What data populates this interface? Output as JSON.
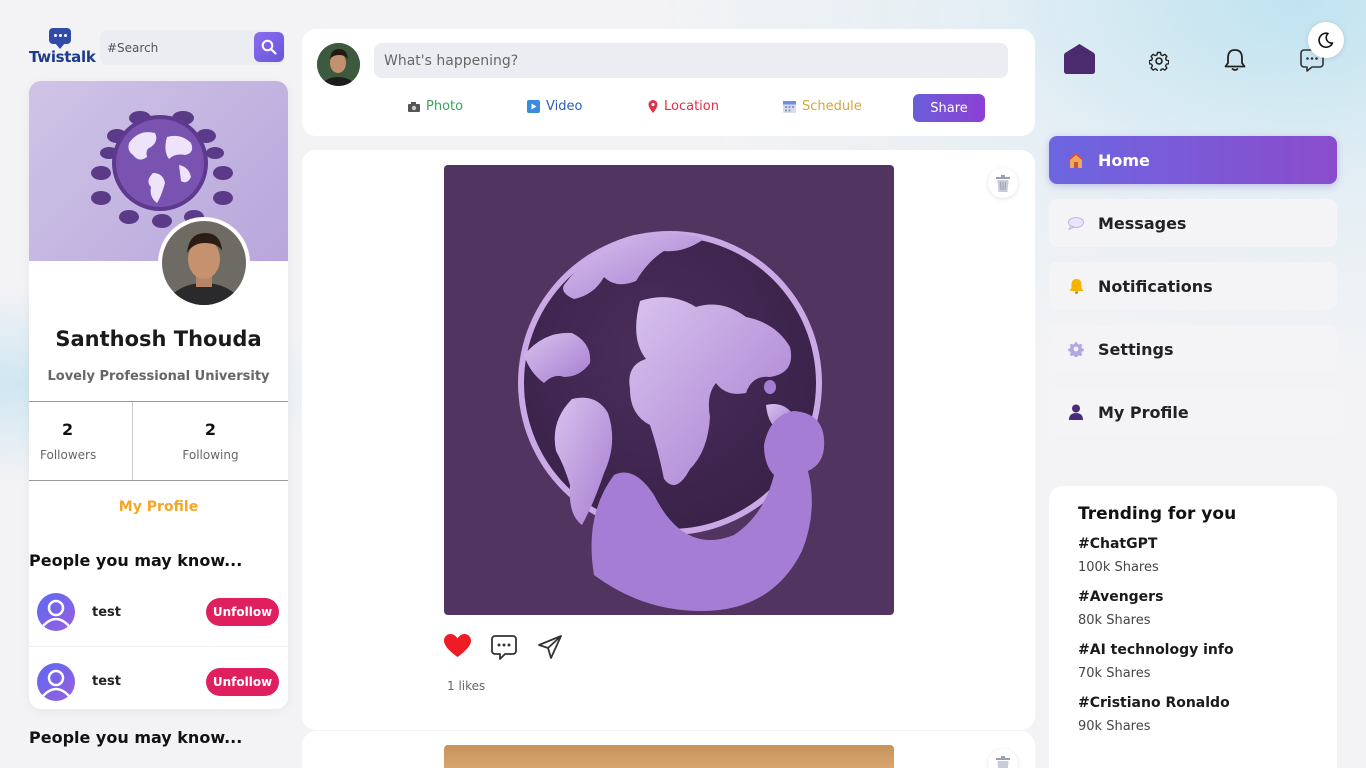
{
  "app": {
    "name": "Twistalk"
  },
  "search": {
    "placeholder": "#Search"
  },
  "profile": {
    "name": "Santhosh Thouda",
    "university": "Lovely Professional University",
    "followers_count": "2",
    "followers_label": "Followers",
    "following_count": "2",
    "following_label": "Following",
    "my_profile_link": "My Profile"
  },
  "suggestions": {
    "title": "People you may know...",
    "items": [
      {
        "name": "test",
        "action": "Unfollow"
      },
      {
        "name": "test",
        "action": "Unfollow"
      }
    ],
    "title_repeat": "People you may know..."
  },
  "composer": {
    "placeholder": "What's happening?",
    "actions": [
      {
        "label": "Photo",
        "color": "#3aa55a",
        "icon": "camera-icon"
      },
      {
        "label": "Video",
        "color": "#2c5bb8",
        "icon": "video-icon"
      },
      {
        "label": "Location",
        "color": "#e0304a",
        "icon": "location-pin-icon"
      },
      {
        "label": "Schedule",
        "color": "#d6a43a",
        "icon": "calendar-icon"
      }
    ],
    "share_label": "Share"
  },
  "post": {
    "likes_text": "1 likes",
    "liked": true
  },
  "nav": {
    "items": [
      {
        "label": "Home",
        "icon": "home-icon",
        "active": true
      },
      {
        "label": "Messages",
        "icon": "speech-bubble-icon",
        "active": false
      },
      {
        "label": "Notifications",
        "icon": "bell-icon",
        "active": false
      },
      {
        "label": "Settings",
        "icon": "gear-icon",
        "active": false
      },
      {
        "label": "My Profile",
        "icon": "person-icon",
        "active": false
      }
    ]
  },
  "trending": {
    "title": "Trending for you",
    "items": [
      {
        "tag": "#ChatGPT",
        "shares": "100k Shares"
      },
      {
        "tag": "#Avengers",
        "shares": "80k Shares"
      },
      {
        "tag": "#AI technology info",
        "shares": "70k Shares"
      },
      {
        "tag": "#Cristiano Ronaldo",
        "shares": "90k Shares"
      }
    ]
  },
  "colors": {
    "accent": "#6d66e0",
    "unfollow": "#e0205e",
    "profile_link": "#f5a623",
    "post_bg": "#51345f"
  }
}
